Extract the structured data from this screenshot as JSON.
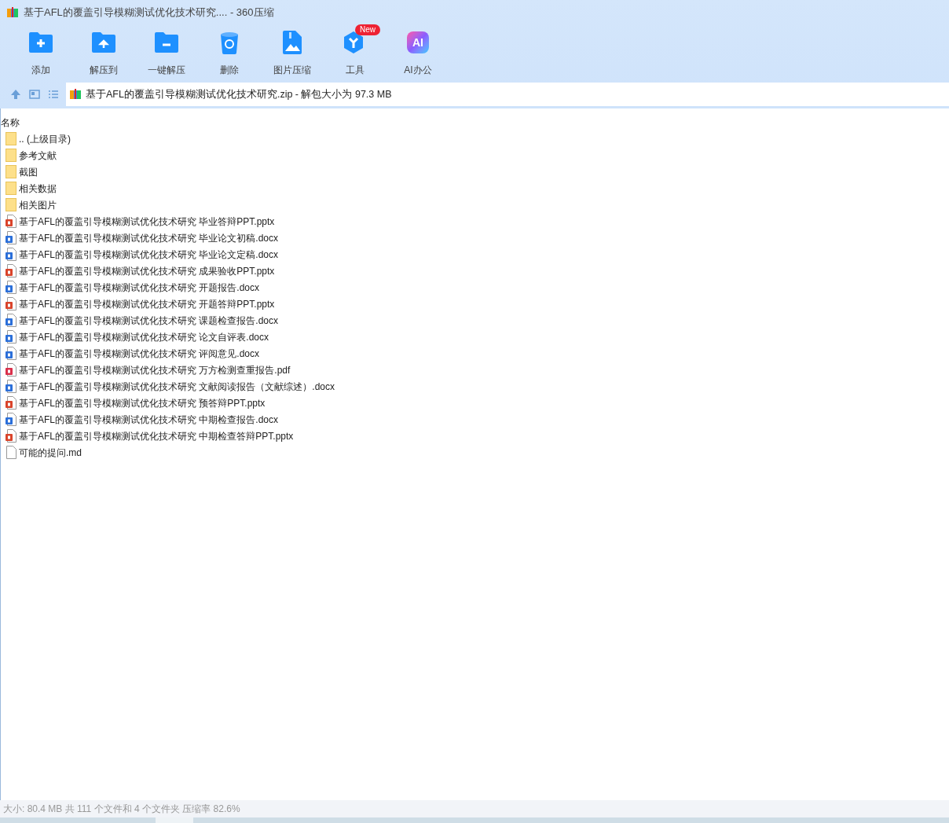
{
  "window": {
    "title": "基于AFL的覆盖引导模糊测试优化技术研究.... - 360压缩"
  },
  "toolbar": [
    {
      "kind": "add",
      "label": "添加"
    },
    {
      "kind": "extract_to",
      "label": "解压到"
    },
    {
      "kind": "quick_extract",
      "label": "一键解压"
    },
    {
      "kind": "delete",
      "label": "删除"
    },
    {
      "kind": "image",
      "label": "图片压缩"
    },
    {
      "kind": "tools",
      "label": "工具",
      "badge": "New"
    },
    {
      "kind": "ai",
      "label": "AI办公",
      "icon_text": "AI"
    }
  ],
  "address_bar": {
    "path": "基于AFL的覆盖引导模糊测试优化技术研究.zip - 解包大小为 97.3 MB"
  },
  "file_list": {
    "columns": [
      "名称"
    ],
    "rows": [
      {
        "kind": "folder",
        "name": ".. (上级目录)"
      },
      {
        "kind": "folder",
        "name": "参考文献"
      },
      {
        "kind": "folder",
        "name": "截图"
      },
      {
        "kind": "folder",
        "name": "相关数据"
      },
      {
        "kind": "folder",
        "name": "相关图片"
      },
      {
        "kind": "pptx",
        "name": "基于AFL的覆盖引导模糊测试优化技术研究 毕业答辩PPT.pptx"
      },
      {
        "kind": "docx",
        "name": "基于AFL的覆盖引导模糊测试优化技术研究 毕业论文初稿.docx"
      },
      {
        "kind": "docx",
        "name": "基于AFL的覆盖引导模糊测试优化技术研究 毕业论文定稿.docx"
      },
      {
        "kind": "pptx",
        "name": "基于AFL的覆盖引导模糊测试优化技术研究 成果验收PPT.pptx"
      },
      {
        "kind": "docx",
        "name": "基于AFL的覆盖引导模糊测试优化技术研究 开题报告.docx"
      },
      {
        "kind": "pptx",
        "name": "基于AFL的覆盖引导模糊测试优化技术研究 开题答辩PPT.pptx"
      },
      {
        "kind": "docx",
        "name": "基于AFL的覆盖引导模糊测试优化技术研究 课题检查报告.docx"
      },
      {
        "kind": "docx",
        "name": "基于AFL的覆盖引导模糊测试优化技术研究 论文自评表.docx"
      },
      {
        "kind": "docx",
        "name": "基于AFL的覆盖引导模糊测试优化技术研究 评阅意见.docx"
      },
      {
        "kind": "pdf",
        "name": "基于AFL的覆盖引导模糊测试优化技术研究 万方检测查重报告.pdf"
      },
      {
        "kind": "docx",
        "name": "基于AFL的覆盖引导模糊测试优化技术研究 文献阅读报告（文献综述）.docx"
      },
      {
        "kind": "pptx",
        "name": "基于AFL的覆盖引导模糊测试优化技术研究 预答辩PPT.pptx"
      },
      {
        "kind": "docx",
        "name": "基于AFL的覆盖引导模糊测试优化技术研究 中期检查报告.docx"
      },
      {
        "kind": "pptx",
        "name": "基于AFL的覆盖引导模糊测试优化技术研究 中期检查答辩PPT.pptx"
      },
      {
        "kind": "text",
        "name": "可能的提问.md"
      }
    ]
  },
  "status_bar": {
    "text": "大小: 80.4 MB 共 111 个文件和 4 个文件夹 压缩率 82.6%"
  }
}
